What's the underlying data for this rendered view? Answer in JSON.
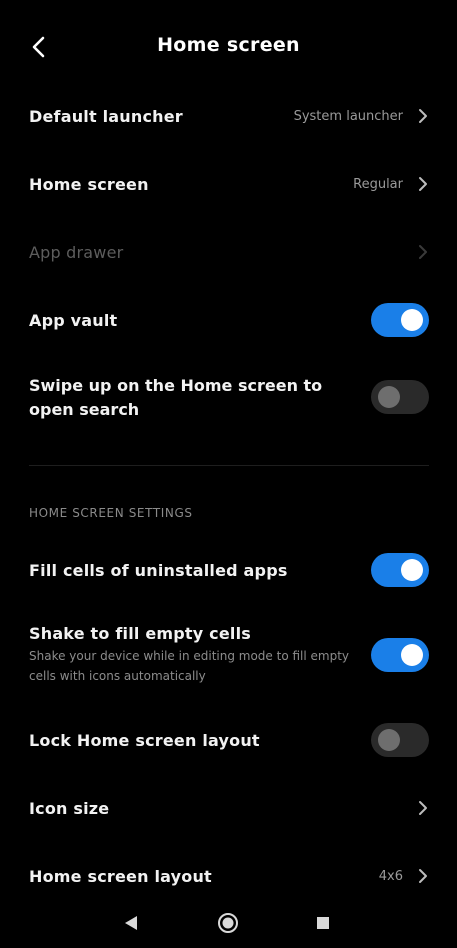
{
  "header": {
    "title": "Home screen",
    "back_icon": "chevron-left-icon"
  },
  "rows": {
    "default_launcher": {
      "label": "Default launcher",
      "value": "System launcher"
    },
    "home_screen": {
      "label": "Home screen",
      "value": "Regular"
    },
    "app_drawer": {
      "label": "App drawer",
      "enabled": false
    },
    "app_vault": {
      "label": "App vault",
      "toggle": true
    },
    "swipe_up": {
      "label": "Swipe up on the Home screen to open search",
      "toggle": false
    }
  },
  "section": {
    "title": "HOME SCREEN SETTINGS",
    "fill_cells": {
      "label": "Fill cells of uninstalled apps",
      "toggle": true
    },
    "shake_fill": {
      "label": "Shake to fill empty cells",
      "description": "Shake your device while in editing mode to fill empty cells with icons automatically",
      "toggle": true
    },
    "lock_layout": {
      "label": "Lock Home screen layout",
      "toggle": false
    },
    "icon_size": {
      "label": "Icon size"
    },
    "layout": {
      "label": "Home screen layout",
      "value": "4x6"
    }
  },
  "navbar": {
    "back": "triangle-back-icon",
    "home": "circle-home-icon",
    "recents": "square-recents-icon"
  },
  "colors": {
    "accent": "#1a7fe8",
    "background": "#000000",
    "text": "#f2f2f2",
    "secondary_text": "#9a9a9a",
    "disabled_text": "#5d5d5d"
  }
}
